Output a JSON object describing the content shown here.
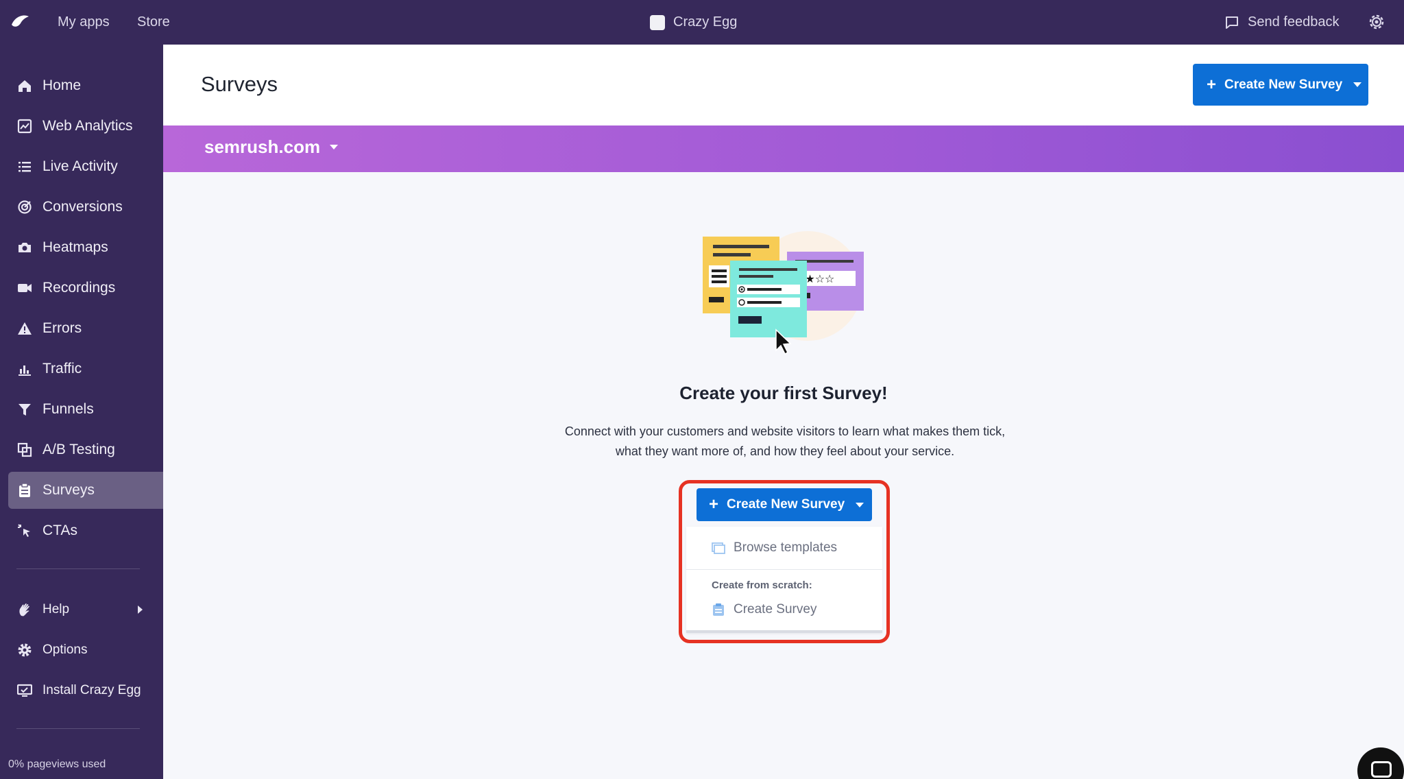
{
  "topbar": {
    "nav": [
      "My apps",
      "Store"
    ],
    "app_name": "Crazy Egg",
    "feedback": "Send feedback"
  },
  "sidebar": {
    "items": [
      {
        "label": "Home",
        "icon": "home-icon"
      },
      {
        "label": "Web Analytics",
        "icon": "chart-icon"
      },
      {
        "label": "Live Activity",
        "icon": "list-icon"
      },
      {
        "label": "Conversions",
        "icon": "target-icon"
      },
      {
        "label": "Heatmaps",
        "icon": "camera-icon"
      },
      {
        "label": "Recordings",
        "icon": "video-icon"
      },
      {
        "label": "Errors",
        "icon": "warning-icon"
      },
      {
        "label": "Traffic",
        "icon": "bar-chart-icon"
      },
      {
        "label": "Funnels",
        "icon": "funnel-icon"
      },
      {
        "label": "A/B Testing",
        "icon": "ab-test-icon"
      },
      {
        "label": "Surveys",
        "icon": "clipboard-icon",
        "active": true
      },
      {
        "label": "CTAs",
        "icon": "cursor-click-icon"
      }
    ],
    "secondary": [
      {
        "label": "Help",
        "icon": "wave-hand-icon"
      },
      {
        "label": "Options",
        "icon": "gear-icon"
      },
      {
        "label": "Install Crazy Egg",
        "icon": "monitor-icon"
      }
    ],
    "footer": "0% pageviews used"
  },
  "main": {
    "title": "Surveys",
    "create_button": "Create New Survey",
    "site": "semrush.com",
    "empty_title": "Create your first Survey!",
    "empty_desc": "Connect with your customers and website visitors to learn what makes them tick, what they want more of, and how they feel about your service."
  },
  "dropdown": {
    "button": "Create New Survey",
    "browse": "Browse templates",
    "scratch_label": "Create from scratch:",
    "create": "Create Survey"
  },
  "colors": {
    "topbar": "#37295a",
    "primary": "#0d6fd6",
    "band_start": "#b867d9",
    "band_end": "#8a4fd0",
    "highlight": "#e63223"
  }
}
